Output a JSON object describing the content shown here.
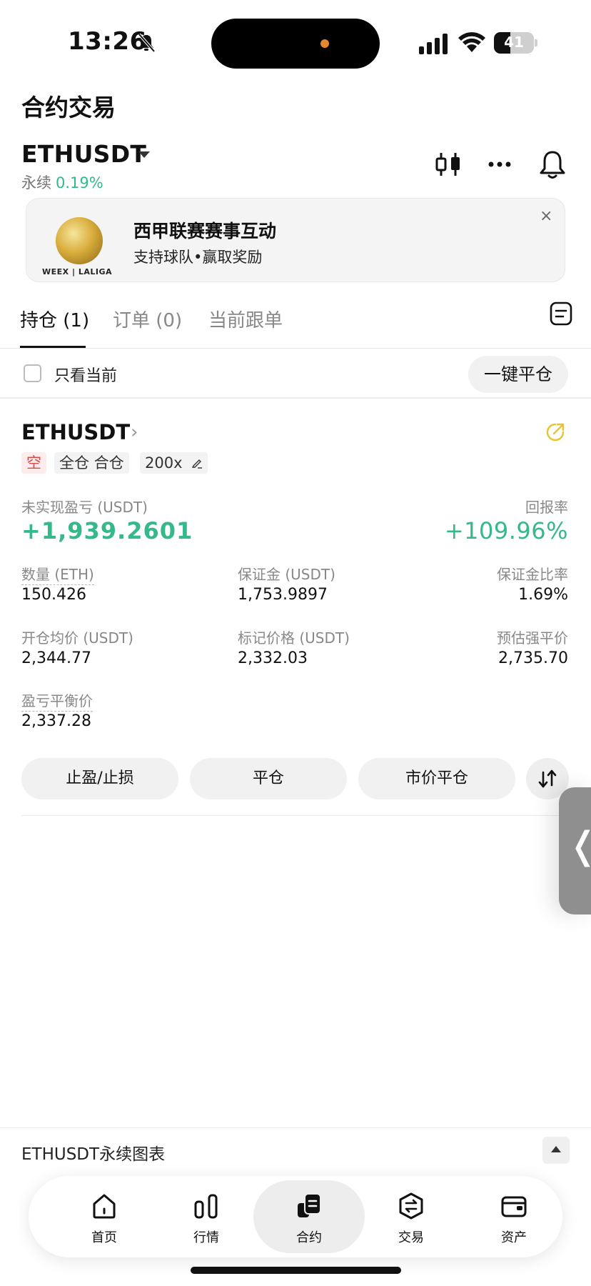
{
  "status_bar": {
    "time": "13:26",
    "battery": "41",
    "battery_level": 0.41
  },
  "page": {
    "title": "合约交易"
  },
  "market": {
    "symbol": "ETHUSDT",
    "contract_type": "永续",
    "change": "0.19%"
  },
  "banner": {
    "title": "西甲联赛赛事互动",
    "subtitle": "支持球队•赢取奖励",
    "logo_text": "WEEX | LALIGA",
    "close": "×"
  },
  "tabs": [
    {
      "label": "持仓 (1)"
    },
    {
      "label": "订单 (0)"
    },
    {
      "label": "当前跟单"
    }
  ],
  "filter": {
    "label": "只看当前",
    "close_all": "一键平仓"
  },
  "position": {
    "symbol": "ETHUSDT",
    "chevron": "›",
    "side_tag": "空",
    "margin_tag": "全仓 合仓",
    "leverage_tag": "200x",
    "unrealized_label": "未实现盈亏 (USDT)",
    "unrealized_value": "+1,939.2601",
    "roe_label": "回报率",
    "roe_value": "+109.96%",
    "qty_label": "数量 (ETH)",
    "qty_value": "150.426",
    "margin_label": "保证金 (USDT)",
    "margin_value": "1,753.9897",
    "margin_ratio_label": "保证金比率",
    "margin_ratio_value": "1.69%",
    "entry_label": "开仓均价 (USDT)",
    "entry_value": "2,344.77",
    "mark_label": "标记价格 (USDT)",
    "mark_value": "2,332.03",
    "liq_label": "预估强平价",
    "liq_value": "2,735.70",
    "breakeven_label": "盈亏平衡价",
    "breakeven_value": "2,337.28"
  },
  "actions": {
    "tp_sl": "止盈/止损",
    "close": "平仓",
    "market_close": "市价平仓"
  },
  "side_handle": {
    "glyph": "❬"
  },
  "chart_bar": {
    "label": "ETHUSDT永续图表"
  },
  "nav": [
    {
      "label": "首页",
      "icon": "home-icon"
    },
    {
      "label": "行情",
      "icon": "market-icon"
    },
    {
      "label": "合约",
      "icon": "futures-icon"
    },
    {
      "label": "交易",
      "icon": "trade-icon"
    },
    {
      "label": "资产",
      "icon": "wallet-icon"
    }
  ],
  "colors": {
    "positive": "#35b88a",
    "short": "#e04848",
    "share": "#e8c330"
  }
}
